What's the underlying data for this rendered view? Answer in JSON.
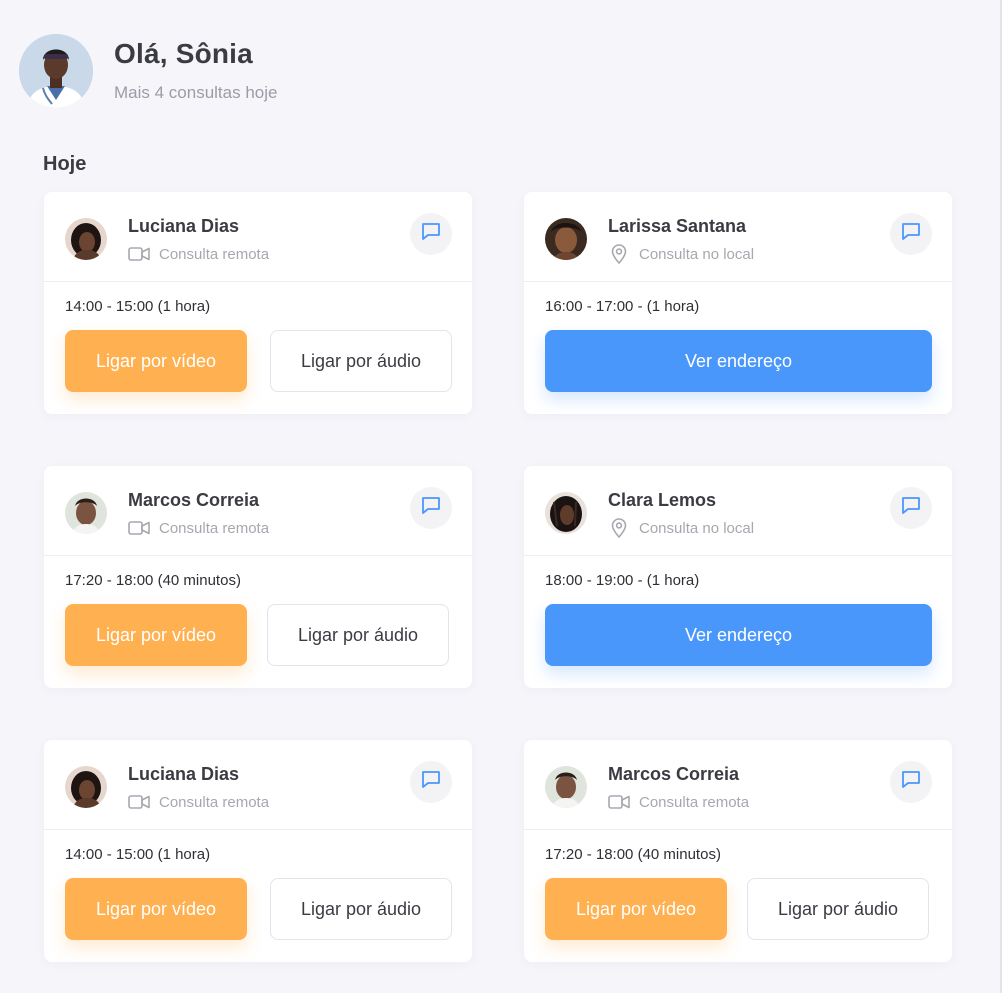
{
  "header": {
    "greeting": "Olá, Sônia",
    "subtitle": "Mais 4 consultas hoje"
  },
  "section": {
    "title": "Hoje"
  },
  "cards": [
    {
      "name": "Luciana Dias",
      "type": "Consulta remota",
      "type_icon": "video-camera-icon",
      "time": "14:00 - 15:00 (1 hora)",
      "video_label": "Ligar por vídeo",
      "audio_label": "Ligar por áudio"
    },
    {
      "name": "Larissa Santana",
      "type": "Consulta no local",
      "type_icon": "location-pin-icon",
      "time": "16:00 - 17:00 - (1 hora)",
      "address_label": "Ver endereço"
    },
    {
      "name": "Marcos Correia",
      "type": "Consulta remota",
      "type_icon": "video-camera-icon",
      "time": "17:20 - 18:00 (40 minutos)",
      "video_label": "Ligar por vídeo",
      "audio_label": "Ligar por áudio"
    },
    {
      "name": "Clara Lemos",
      "type": "Consulta no local",
      "type_icon": "location-pin-icon",
      "time": "18:00 - 19:00 - (1 hora)",
      "address_label": "Ver endereço"
    },
    {
      "name": "Luciana Dias",
      "type": "Consulta remota",
      "type_icon": "video-camera-icon",
      "time": "14:00 - 15:00 (1 hora)",
      "video_label": "Ligar por vídeo",
      "audio_label": "Ligar por áudio"
    },
    {
      "name": "Marcos Correia",
      "type": "Consulta remota",
      "type_icon": "video-camera-icon",
      "time": "17:20 - 18:00 (40 minutos)",
      "video_label": "Ligar por vídeo",
      "audio_label": "Ligar por áudio"
    }
  ],
  "colors": {
    "video_button": "#ffb151",
    "address_button": "#4a97fc",
    "chat_icon": "#4a97fc",
    "background": "#f6f5fa"
  }
}
